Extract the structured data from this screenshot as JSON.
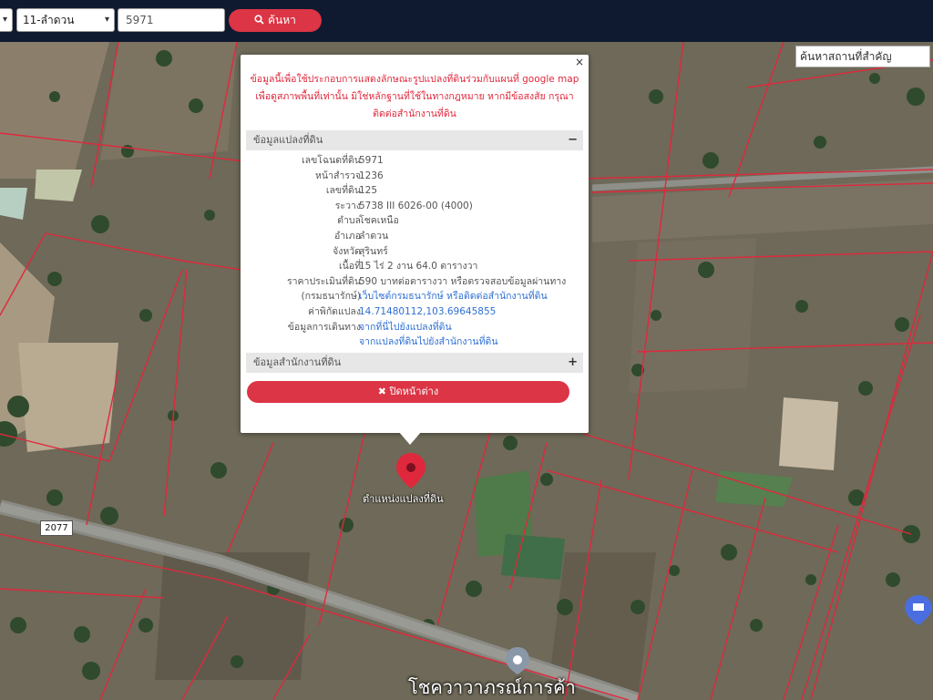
{
  "toolbar": {
    "district_select": "11-ลำดวน",
    "parcel_input": "5971",
    "search_button": "ค้นหา"
  },
  "map": {
    "place_search_placeholder": "ค้นหาสถานที่สำคัญ",
    "marker_label": "ตำแหน่งแปลงที่ดิน",
    "road_number": "2077",
    "place_label": "โชควาวาภรณ์การค้า"
  },
  "popup": {
    "notice_line1": "ข้อมูลนี้เพื่อใช้ประกอบการแสดงลักษณะรูปแปลงที่ดินร่วมกับแผนที่ google map",
    "notice_line2": "เพื่อดูสภาพพื้นที่เท่านั้น มิใช่หลักฐานที่ใช้ในทางกฎหมาย หากมีข้อสงสัย กรุณา",
    "notice_line3": "ติดต่อสำนักงานที่ดิน",
    "section1_title": "ข้อมูลแปลงที่ดิน",
    "section1_toggle": "−",
    "rows": [
      {
        "k": "เลขโฉนดที่ดิน",
        "v": "5971"
      },
      {
        "k": "หน้าสำรวจ",
        "v": "1236"
      },
      {
        "k": "เลขที่ดิน",
        "v": "125"
      },
      {
        "k": "ระวาง",
        "v": "5738 III 6026-00 (4000)"
      },
      {
        "k": "ตำบล",
        "v": "โชคเหนือ"
      },
      {
        "k": "อำเภอ",
        "v": "ลำดวน"
      },
      {
        "k": "จังหวัด",
        "v": "สุรินทร์"
      },
      {
        "k": "เนื้อที่",
        "v": "15 ไร่ 2 งาน 64.0 ตารางวา"
      },
      {
        "k": "ราคาประเมินที่ดิน",
        "v": "590 บาทต่อตารางวา หรือตรวจสอบข้อมูลผ่านทาง"
      },
      {
        "k": "(กรมธนารักษ์)",
        "v": "เว็บไซต์กรมธนารักษ์ หรือติดต่อสำนักงานที่ดิน"
      },
      {
        "k": "ค่าพิกัดแปลง",
        "v": "14.71480112,103.69645855"
      },
      {
        "k": "ข้อมูลการเดินทาง",
        "v": "จากที่นี่ไปยังแปลงที่ดิน"
      },
      {
        "k": "",
        "v": "จากแปลงที่ดินไปยังสำนักงานที่ดิน"
      }
    ],
    "section2_title": "ข้อมูลสำนักงานที่ดิน",
    "section2_toggle": "+",
    "close_button": "ปิดหน้าต่าง",
    "close_x": "×"
  }
}
